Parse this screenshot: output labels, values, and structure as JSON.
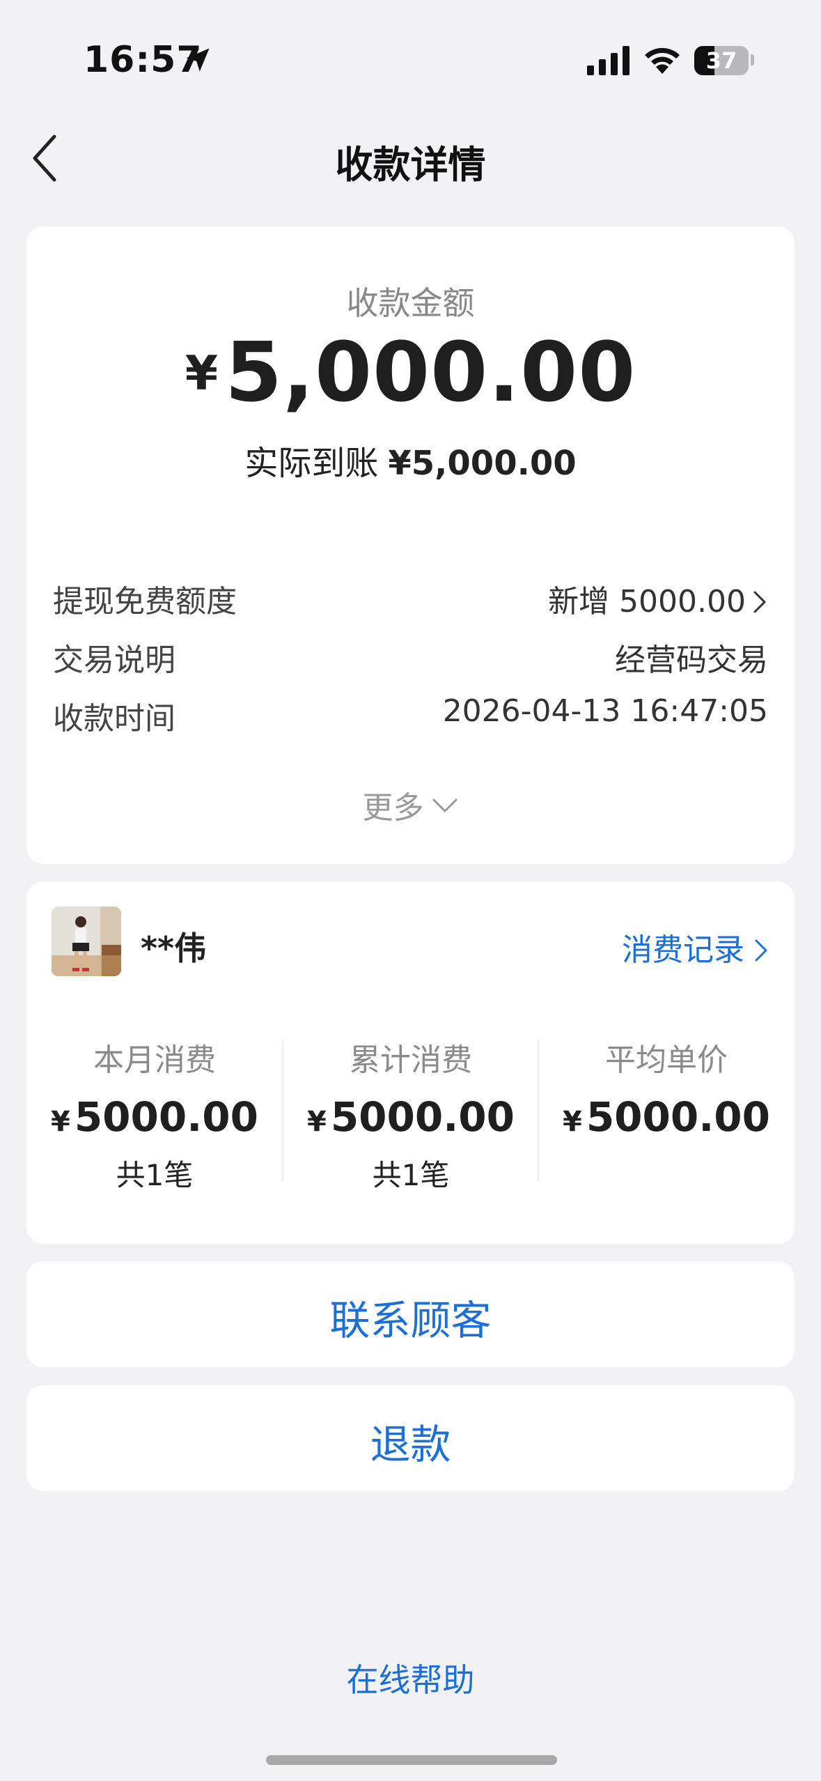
{
  "status_bar": {
    "time": "16:57",
    "battery": "37",
    "battery_level": 0.37
  },
  "nav": {
    "title": "收款详情"
  },
  "payment": {
    "amount_label": "收款金额",
    "currency_symbol": "¥",
    "amount": "5,000.00",
    "actual_label": "实际到账",
    "actual_amount": "¥5,000.00",
    "details": [
      {
        "label": "提现免费额度",
        "value": "新增 5000.00"
      },
      {
        "label": "交易说明",
        "value": "经营码交易"
      },
      {
        "label": "收款时间",
        "value": "2026-04-13 16:47:05"
      }
    ],
    "more_label": "更多"
  },
  "customer": {
    "name": "**伟",
    "record_link": "消费记录",
    "stats": [
      {
        "label": "本月消费",
        "currency": "¥",
        "value": "5000.00",
        "count": "共1笔"
      },
      {
        "label": "累计消费",
        "currency": "¥",
        "value": "5000.00",
        "count": "共1笔"
      },
      {
        "label": "平均单价",
        "currency": "¥",
        "value": "5000.00",
        "count": ""
      }
    ]
  },
  "actions": {
    "contact_label": "联系顾客",
    "refund_label": "退款"
  },
  "footer": {
    "help_label": "在线帮助"
  },
  "colors": {
    "accent": "#1d6fd8",
    "background": "#f2f2f4",
    "card": "#ffffff"
  }
}
